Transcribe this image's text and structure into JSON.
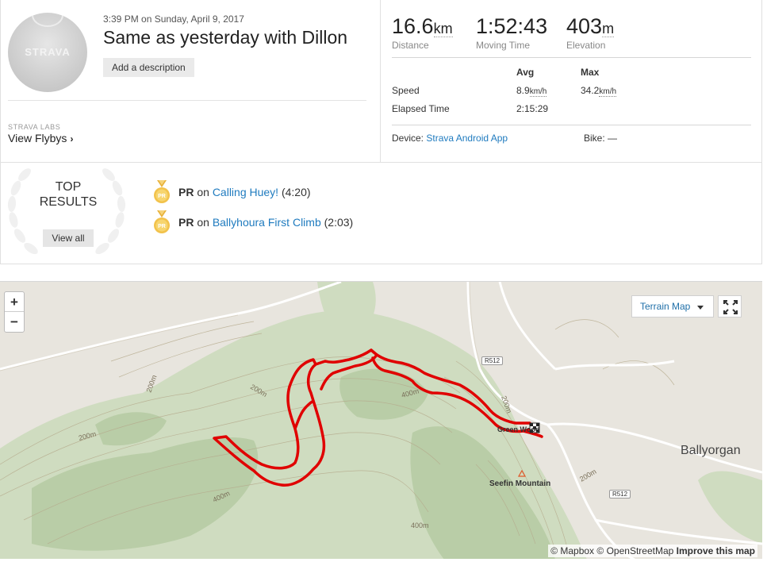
{
  "header": {
    "datetime": "3:39 PM on Sunday, April 9, 2017",
    "title": "Same as yesterday with Dillon",
    "add_description_label": "Add a description",
    "avatar_brand": "STRAVA"
  },
  "labs": {
    "label": "STRAVA LABS",
    "link_label": "View Flybys",
    "link_chevron": "›"
  },
  "stats": [
    {
      "value": "16.6",
      "unit": "km",
      "label": "Distance"
    },
    {
      "value": "1:52:43",
      "unit": "",
      "label": "Moving Time"
    },
    {
      "value": "403",
      "unit": "m",
      "label": "Elevation"
    }
  ],
  "details_table": {
    "headers": {
      "avg": "Avg",
      "max": "Max"
    },
    "speed": {
      "label": "Speed",
      "avg_value": "8.9",
      "avg_unit": "km/h",
      "max_value": "34.2",
      "max_unit": "km/h"
    },
    "elapsed": {
      "label": "Elapsed Time",
      "avg_value": "2:15:29"
    }
  },
  "device": {
    "label": "Device:",
    "value": "Strava Android App",
    "bike_label": "Bike:",
    "bike_value": "—"
  },
  "results": {
    "heading_line1": "TOP",
    "heading_line2": "RESULTS",
    "view_all_label": "View all",
    "items": [
      {
        "badge": "PR",
        "kind": "PR",
        "on": "on",
        "segment": "Calling Huey!",
        "time": "(4:20)"
      },
      {
        "badge": "PR",
        "kind": "PR",
        "on": "on",
        "segment": "Ballyhoura First Climb",
        "time": "(2:03)"
      }
    ]
  },
  "map": {
    "zoom_in": "+",
    "zoom_out": "−",
    "layer_label": "Terrain Map",
    "town_label": "Ballyorgan",
    "mountain_label": "Seefin Mountain",
    "green_label": "Green Wood",
    "road_labels": [
      "R512",
      "R512"
    ],
    "contour_labels": [
      "200m",
      "200m",
      "200m",
      "200m",
      "400m",
      "400m",
      "400m",
      "200m",
      "200m",
      "200m"
    ],
    "attribution": {
      "mapbox": "© Mapbox",
      "osm": "© OpenStreetMap",
      "improve": "Improve this map"
    },
    "route_color": "#e00000"
  }
}
